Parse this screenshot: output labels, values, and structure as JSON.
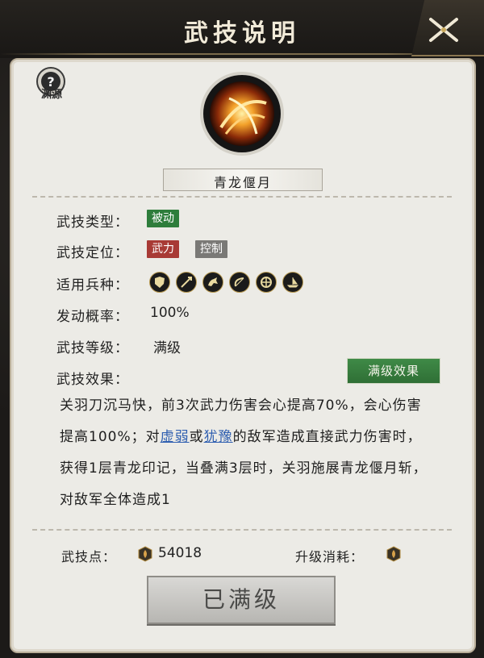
{
  "header": {
    "title": "武技说明"
  },
  "origin": {
    "label": "渊源"
  },
  "skill": {
    "name": "青龙偃月",
    "rows": {
      "type_label": "武技类型：",
      "type_tag": "被动",
      "position_label": "武技定位：",
      "position_tags": [
        "武力",
        "控制"
      ],
      "units_label": "适用兵种：",
      "units": [
        "shield-unit-icon",
        "spear-unit-icon",
        "cavalry-unit-icon",
        "bow-unit-icon",
        "chariot-unit-icon",
        "ship-unit-icon"
      ],
      "trigger_label": "发动概率：",
      "trigger_value": "100%",
      "level_label": "武技等级：",
      "level_value": "满级",
      "effect_label": "武技效果："
    },
    "max_effect_button": "满级效果",
    "description": {
      "p1": "关羽刀沉马快，前3次武力伤害会心提高70%，会心伤害提高100%；对",
      "link1": "虚弱",
      "p2": "或",
      "link2": "犹豫",
      "p3": "的敌军造成直接武力伤害时，获得1层青龙印记，当叠满3层时，关羽施展青龙偃月斩，对敌军全体造成1"
    }
  },
  "footer": {
    "points_label": "武技点：",
    "points_value": "54018",
    "cost_label": "升级消耗：",
    "maxed_button": "已满级"
  },
  "colors": {
    "passive_tag": "#2e7d3b",
    "force_tag": "#a83a35",
    "control_tag": "#7a7976",
    "link": "#2f5fb0",
    "button_green": "#3f8a47"
  }
}
